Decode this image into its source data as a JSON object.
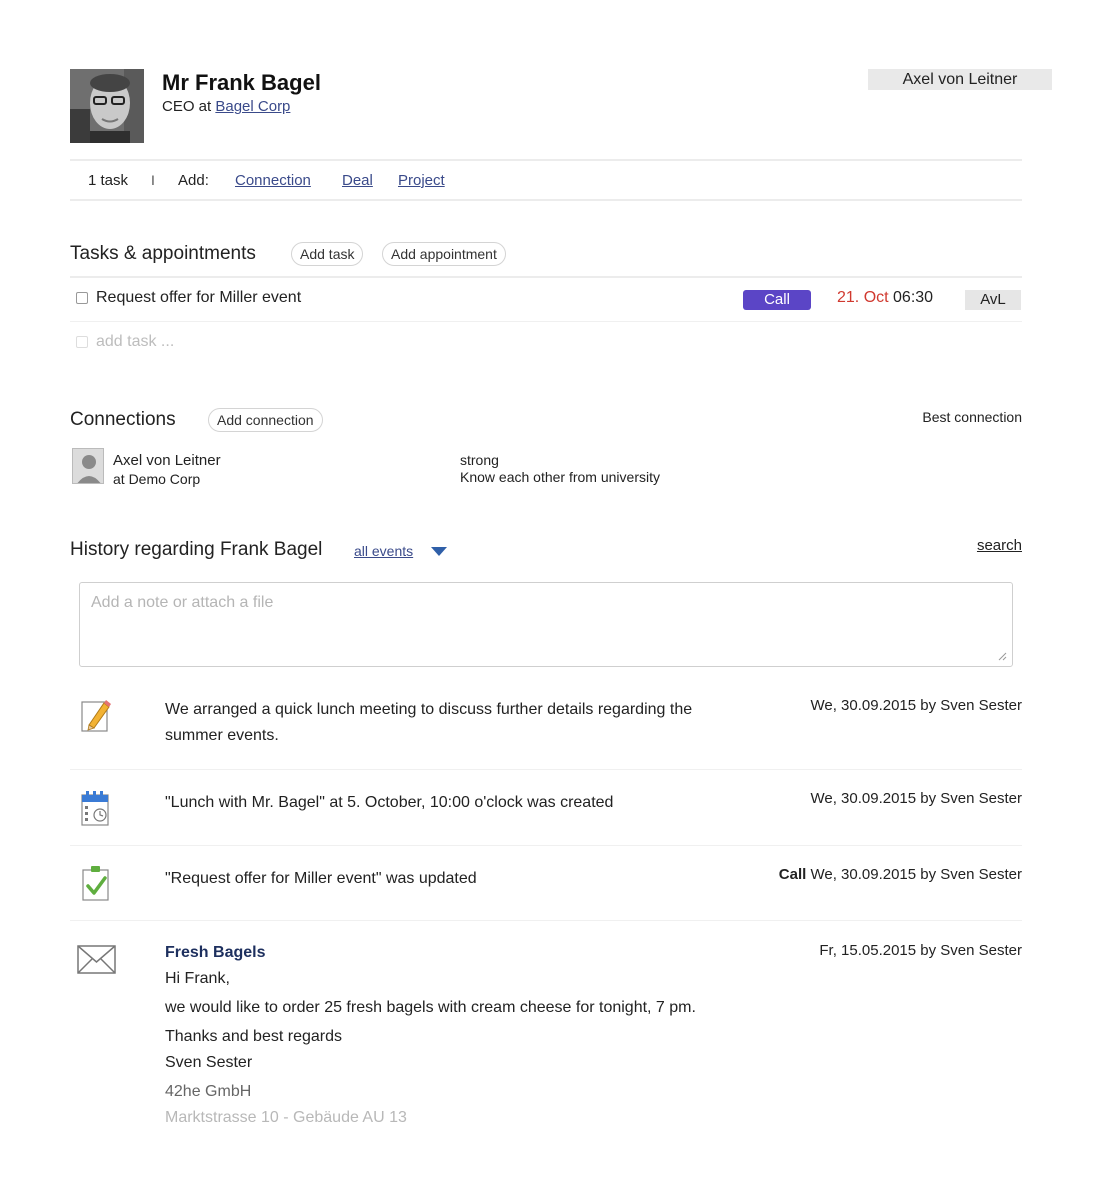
{
  "contact": {
    "name": "Mr Frank Bagel",
    "role_prefix": "CEO at",
    "company": "Bagel Corp",
    "owner": "Axel von Leitner"
  },
  "actions": {
    "task_count": "1 task",
    "separator": "I",
    "add_label": "Add:",
    "links": [
      "Connection",
      "Deal",
      "Project"
    ]
  },
  "tasks": {
    "title": "Tasks & appointments",
    "add_task": "Add task",
    "add_appointment": "Add appointment",
    "items": [
      {
        "label": "Request offer for Miller event",
        "type": "Call",
        "date": "21. Oct",
        "time": "06:30",
        "assignee": "AvL"
      }
    ],
    "new_task_placeholder": "add task ..."
  },
  "connections": {
    "title": "Connections",
    "add_button": "Add connection",
    "best_label": "Best connection",
    "items": [
      {
        "name": "Axel von Leitner",
        "company": "at Demo Corp",
        "strength": "strong",
        "note": "Know each other from university"
      }
    ]
  },
  "history": {
    "title": "History regarding Frank Bagel",
    "filter": "all events",
    "search": "search",
    "note_placeholder": "Add a note or attach a file",
    "events": [
      {
        "icon": "pencil-note-icon",
        "text_line1": "We arranged a quick lunch meeting to discuss further details regarding the",
        "text_line2": "summer events.",
        "meta": "We, 30.09.2015 by Sven Sester"
      },
      {
        "icon": "calendar-icon",
        "text_line1": "\"Lunch with Mr. Bagel\" at 5. October, 10:00 o'clock was created",
        "meta": "We, 30.09.2015 by Sven Sester"
      },
      {
        "icon": "task-check-icon",
        "text_line1": "\"Request offer for Miller event\" was updated",
        "meta_prefix": "Call",
        "meta": "We, 30.09.2015 by Sven Sester"
      }
    ],
    "email": {
      "icon": "envelope-icon",
      "subject": "Fresh Bagels",
      "lines": [
        "Hi Frank,",
        "we would like to order 25 fresh bagels with cream cheese for tonight, 7 pm.",
        "Thanks and best regards",
        "Sven Sester",
        "42he GmbH",
        "Marktstrasse 10 - Gebäude AU 13"
      ],
      "meta": "Fr, 15.05.2015 by Sven Sester"
    }
  },
  "colors": {
    "accent": "#5b45c6",
    "date_red": "#d0392f",
    "link": "#3a4a8a"
  }
}
